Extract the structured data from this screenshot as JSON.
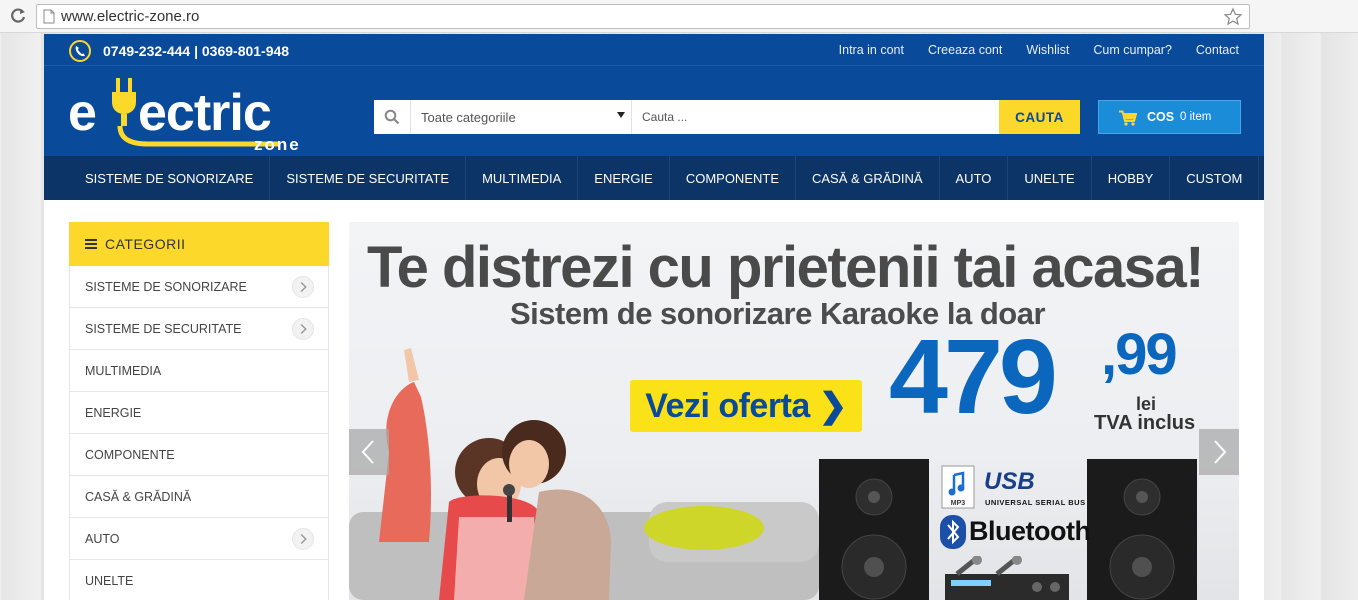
{
  "browser": {
    "url": "www.electric-zone.ro"
  },
  "topbar": {
    "phone": "0749-232-444 | 0369-801-948",
    "links": [
      "Intra in cont",
      "Creeaza cont",
      "Wishlist",
      "Cum cumpar?",
      "Contact"
    ]
  },
  "header": {
    "logo_main": "electric",
    "logo_sub": "zone",
    "search": {
      "category_label": "Toate categoriile",
      "placeholder": "Cauta ...",
      "button": "CAUTA"
    },
    "cart": {
      "label": "COS",
      "count": "0 item"
    }
  },
  "nav": {
    "items": [
      "SISTEME DE SONORIZARE",
      "SISTEME DE SECURITATE",
      "MULTIMEDIA",
      "ENERGIE",
      "COMPONENTE",
      "CASĂ & GRĂDINĂ",
      "AUTO",
      "UNELTE",
      "HOBBY",
      "CUSTOM"
    ]
  },
  "sidebar": {
    "title": "CATEGORII",
    "items": [
      {
        "label": "SISTEME DE SONORIZARE",
        "has_sub": true
      },
      {
        "label": "SISTEME DE SECURITATE",
        "has_sub": true
      },
      {
        "label": "MULTIMEDIA",
        "has_sub": false
      },
      {
        "label": "ENERGIE",
        "has_sub": false
      },
      {
        "label": "COMPONENTE",
        "has_sub": false
      },
      {
        "label": "CASĂ & GRĂDINĂ",
        "has_sub": false
      },
      {
        "label": "AUTO",
        "has_sub": true
      },
      {
        "label": "UNELTE",
        "has_sub": false
      }
    ]
  },
  "banner": {
    "headline": "Te distrezi cu prietenii tai acasa!",
    "subline": "Sistem de sonorizare Karaoke la doar",
    "offer_button": "Vezi oferta ❯",
    "price_int": "479",
    "price_dec": ",99",
    "currency": "lei",
    "vat": "TVA inclus",
    "badges": {
      "mp3": "MP3",
      "usb": "USB",
      "usb_sub": "UNIVERSAL SERIAL BUS",
      "bluetooth": "Bluetooth"
    }
  },
  "colors": {
    "brand_blue": "#0a4a9a",
    "nav_dark": "#0c3466",
    "accent_yellow": "#fbd82a",
    "cart_blue": "#1a8cd8",
    "price_blue": "#0b67be"
  }
}
